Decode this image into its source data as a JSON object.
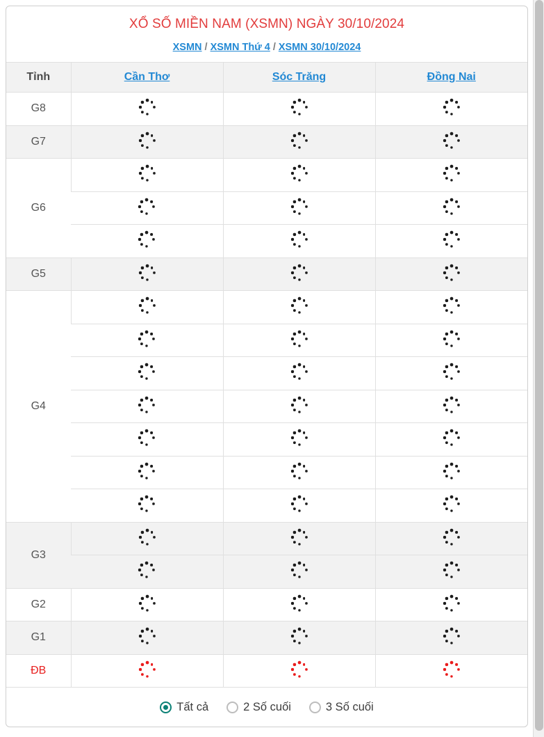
{
  "header": {
    "title": "XỔ SỐ MIỀN NAM (XSMN) NGÀY 30/10/2024",
    "title_color": "#e23c3c",
    "breadcrumb": [
      {
        "label": "XSMN"
      },
      {
        "label": "XSMN Thứ 4"
      },
      {
        "label": "XSMN 30/10/2024"
      }
    ],
    "breadcrumb_separator": "/",
    "link_color": "#2389d4"
  },
  "table": {
    "columns": [
      {
        "label": "Tỉnh",
        "type": "prize-header"
      },
      {
        "label": "Cần Thơ",
        "type": "province"
      },
      {
        "label": "Sóc Trăng",
        "type": "province"
      },
      {
        "label": "Đồng Nai",
        "type": "province"
      }
    ],
    "loading_icon": "loading-spinner-icon",
    "special_color": "#e8201f",
    "rows": [
      {
        "prize": "G8",
        "count": 1,
        "shaded": false,
        "special": false
      },
      {
        "prize": "G7",
        "count": 1,
        "shaded": true,
        "special": false
      },
      {
        "prize": "G6",
        "count": 3,
        "shaded": false,
        "special": false
      },
      {
        "prize": "G5",
        "count": 1,
        "shaded": true,
        "special": false
      },
      {
        "prize": "G4",
        "count": 7,
        "shaded": false,
        "special": false
      },
      {
        "prize": "G3",
        "count": 2,
        "shaded": true,
        "special": false
      },
      {
        "prize": "G2",
        "count": 1,
        "shaded": false,
        "special": false
      },
      {
        "prize": "G1",
        "count": 1,
        "shaded": true,
        "special": false
      },
      {
        "prize": "ĐB",
        "count": 1,
        "shaded": false,
        "special": true
      }
    ]
  },
  "filter": {
    "accent_color": "#0c8176",
    "options": [
      {
        "label": "Tất cả",
        "checked": true
      },
      {
        "label": "2 Số cuối",
        "checked": false
      },
      {
        "label": "3 Số cuối",
        "checked": false
      }
    ]
  }
}
